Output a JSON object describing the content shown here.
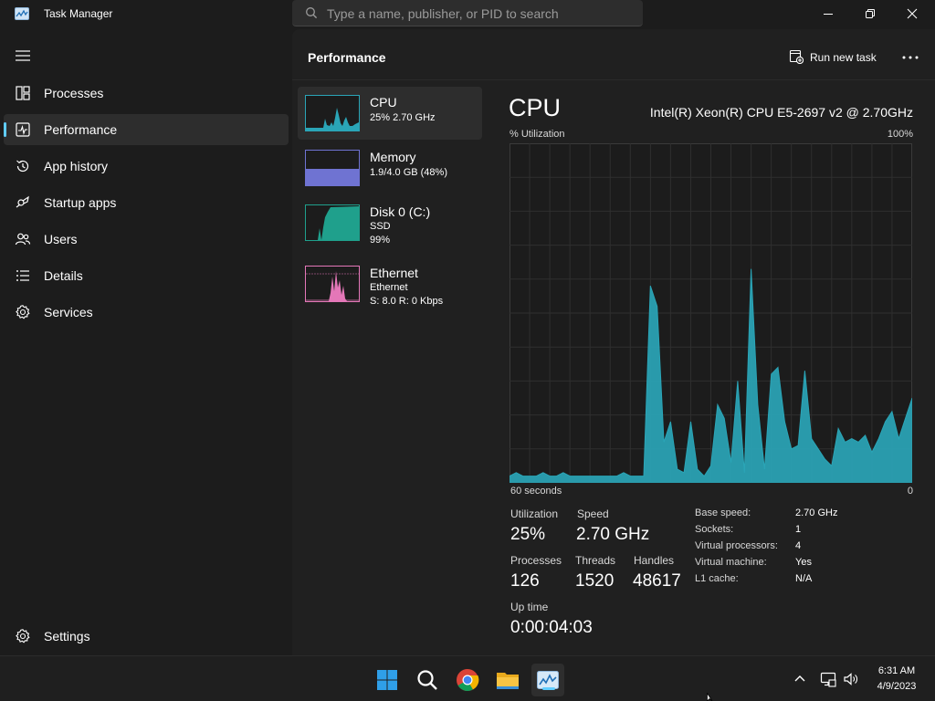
{
  "window": {
    "title": "Task Manager"
  },
  "search": {
    "placeholder": "Type a name, publisher, or PID to search"
  },
  "sidebar": {
    "items": [
      {
        "label": "Processes",
        "icon": "processes-icon"
      },
      {
        "label": "Performance",
        "icon": "performance-icon",
        "active": true
      },
      {
        "label": "App history",
        "icon": "app-history-icon"
      },
      {
        "label": "Startup apps",
        "icon": "startup-apps-icon"
      },
      {
        "label": "Users",
        "icon": "users-icon"
      },
      {
        "label": "Details",
        "icon": "details-icon"
      },
      {
        "label": "Services",
        "icon": "services-icon"
      }
    ],
    "settings": {
      "label": "Settings",
      "icon": "settings-icon"
    }
  },
  "header": {
    "title": "Performance",
    "run_task_label": "Run new task"
  },
  "perf_list": [
    {
      "name": "CPU",
      "sub1": "25%  2.70 GHz",
      "sub2": "",
      "color": "#2aa5b7"
    },
    {
      "name": "Memory",
      "sub1": "1.9/4.0 GB (48%)",
      "sub2": "",
      "color": "#6f73d2"
    },
    {
      "name": "Disk 0 (C:)",
      "sub1": "SSD",
      "sub2": "99%",
      "color": "#1fa08c"
    },
    {
      "name": "Ethernet",
      "sub1": "Ethernet",
      "sub2": "S: 8.0  R: 0 Kbps",
      "color": "#e477b8"
    }
  ],
  "cpu": {
    "title": "CPU",
    "model": "Intel(R) Xeon(R) CPU E5-2697 v2 @ 2.70GHz",
    "graph_label": "% Utilization",
    "graph_max": "100%",
    "time_label": "60 seconds",
    "time_end": "0",
    "stats": {
      "utilization_label": "Utilization",
      "utilization": "25%",
      "speed_label": "Speed",
      "speed": "2.70 GHz",
      "processes_label": "Processes",
      "processes": "126",
      "threads_label": "Threads",
      "threads": "1520",
      "handles_label": "Handles",
      "handles": "48617",
      "uptime_label": "Up time",
      "uptime": "0:00:04:03"
    },
    "specs": [
      {
        "key": "Base speed:",
        "value": "2.70 GHz"
      },
      {
        "key": "Sockets:",
        "value": "1"
      },
      {
        "key": "Virtual processors:",
        "value": "4"
      },
      {
        "key": "Virtual machine:",
        "value": "Yes"
      },
      {
        "key": "L1 cache:",
        "value": "N/A"
      }
    ]
  },
  "chart_data": {
    "type": "area",
    "ylabel": "% Utilization",
    "ylim": [
      0,
      100
    ],
    "xlim": [
      60,
      0
    ],
    "grid": true,
    "color": "#2aa5b7",
    "series": [
      {
        "x": [
          60,
          59,
          58,
          57,
          56,
          55,
          54,
          53,
          52,
          51,
          50,
          49,
          48,
          47,
          46,
          45,
          44,
          43,
          42,
          41,
          40,
          39,
          38,
          37,
          36,
          35,
          34,
          33,
          32,
          31,
          30,
          29,
          28,
          27,
          26,
          25,
          24,
          23,
          22,
          21,
          20,
          19,
          18,
          17,
          16,
          15,
          14,
          13,
          12,
          11,
          10,
          9,
          8,
          7,
          6,
          5,
          4,
          3,
          2,
          1,
          0
        ],
        "values": [
          2,
          3,
          2,
          2,
          2,
          3,
          2,
          2,
          3,
          2,
          2,
          2,
          2,
          2,
          2,
          2,
          2,
          3,
          2,
          2,
          2,
          58,
          52,
          12,
          18,
          4,
          3,
          18,
          4,
          2,
          5,
          23,
          19,
          6,
          30,
          3,
          63,
          23,
          4,
          32,
          34,
          18,
          10,
          11,
          33,
          13,
          10,
          7,
          5,
          16,
          12,
          13,
          12,
          14,
          9,
          13,
          18,
          21,
          13,
          19,
          25
        ]
      }
    ]
  },
  "taskbar": {
    "apps": [
      "start-icon",
      "search-icon",
      "chrome-icon",
      "file-explorer-icon",
      "task-manager-icon"
    ],
    "clock_time": "6:31 AM",
    "clock_date": "4/9/2023"
  }
}
